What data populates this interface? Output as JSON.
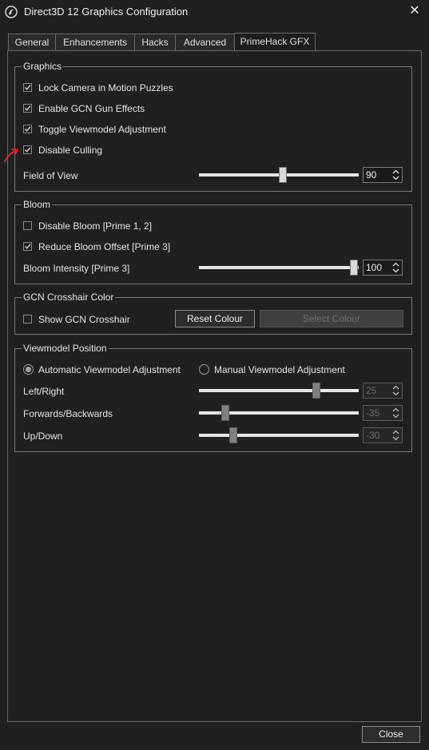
{
  "window": {
    "title": "Direct3D 12 Graphics Configuration",
    "icon": "dolphin-app-icon",
    "close_glyph": "✕"
  },
  "tabs": [
    {
      "label": "General",
      "active": false
    },
    {
      "label": "Enhancements",
      "active": false
    },
    {
      "label": "Hacks",
      "active": false
    },
    {
      "label": "Advanced",
      "active": false
    },
    {
      "label": "PrimeHack GFX",
      "active": true
    }
  ],
  "graphics": {
    "title": "Graphics",
    "lock_camera": {
      "label": "Lock Camera in Motion Puzzles",
      "checked": true
    },
    "gun_effects": {
      "label": "Enable GCN Gun Effects",
      "checked": true
    },
    "viewmodel_adjust": {
      "label": "Toggle Viewmodel Adjustment",
      "checked": true
    },
    "disable_culling": {
      "label": "Disable Culling",
      "checked": true
    },
    "fov": {
      "label": "Field of View",
      "value": "90"
    }
  },
  "bloom": {
    "title": "Bloom",
    "disable_bloom": {
      "label": "Disable Bloom [Prime 1, 2]",
      "checked": false
    },
    "reduce_offset": {
      "label": "Reduce Bloom Offset [Prime 3]",
      "checked": true
    },
    "intensity": {
      "label": "Bloom Intensity [Prime 3]",
      "value": "100"
    }
  },
  "crosshair": {
    "title": "GCN Crosshair Color",
    "show": {
      "label": "Show GCN Crosshair",
      "checked": false
    },
    "reset_label": "Reset Colour",
    "select_label": "Select Colour"
  },
  "viewmodel": {
    "title": "Viewmodel Position",
    "auto": {
      "label": "Automatic Viewmodel Adjustment",
      "selected": true
    },
    "manual": {
      "label": "Manual Viewmodel Adjustment",
      "selected": false
    },
    "left_right": {
      "label": "Left/Right",
      "value": "25"
    },
    "fwd_back": {
      "label": "Forwards/Backwards",
      "value": "-35"
    },
    "up_down": {
      "label": "Up/Down",
      "value": "-30"
    }
  },
  "footer": {
    "close_label": "Close"
  },
  "colors": {
    "background": "#202020",
    "annotation": "#e0202a"
  }
}
